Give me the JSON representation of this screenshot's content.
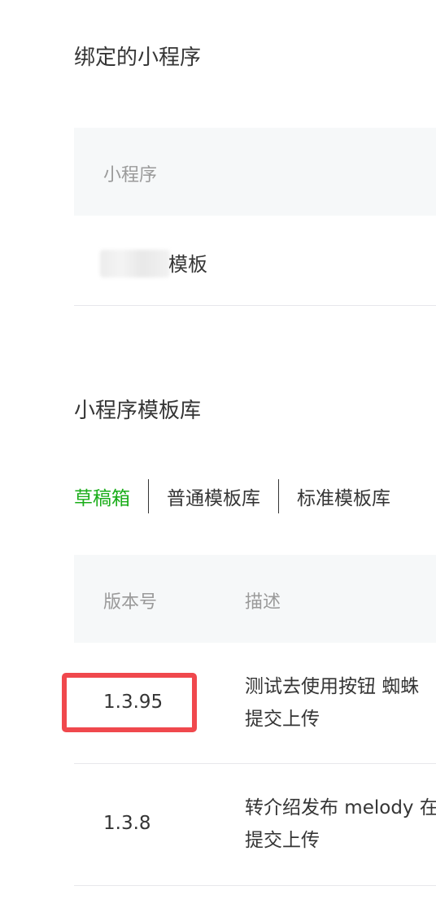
{
  "bound_section": {
    "title": "绑定的小程序",
    "column_header": "小程序",
    "row_name": "模板"
  },
  "library_section": {
    "title": "小程序模板库",
    "tabs": [
      {
        "label": "草稿箱",
        "active": true
      },
      {
        "label": "普通模板库",
        "active": false
      },
      {
        "label": "标准模板库",
        "active": false
      }
    ],
    "columns": {
      "version": "版本号",
      "description": "描述"
    },
    "rows": [
      {
        "version": "1.3.95",
        "description_line1": "测试去使用按钮 蜘蛛",
        "description_line2": "提交上传",
        "highlighted": true
      },
      {
        "version": "1.3.8",
        "description_line1": "转介绍发布 melody 在",
        "description_line2": "提交上传",
        "highlighted": false
      }
    ]
  },
  "colors": {
    "active_tab": "#1aad19",
    "highlight_border": "#f0484d",
    "header_bg": "#f6f8f9"
  }
}
